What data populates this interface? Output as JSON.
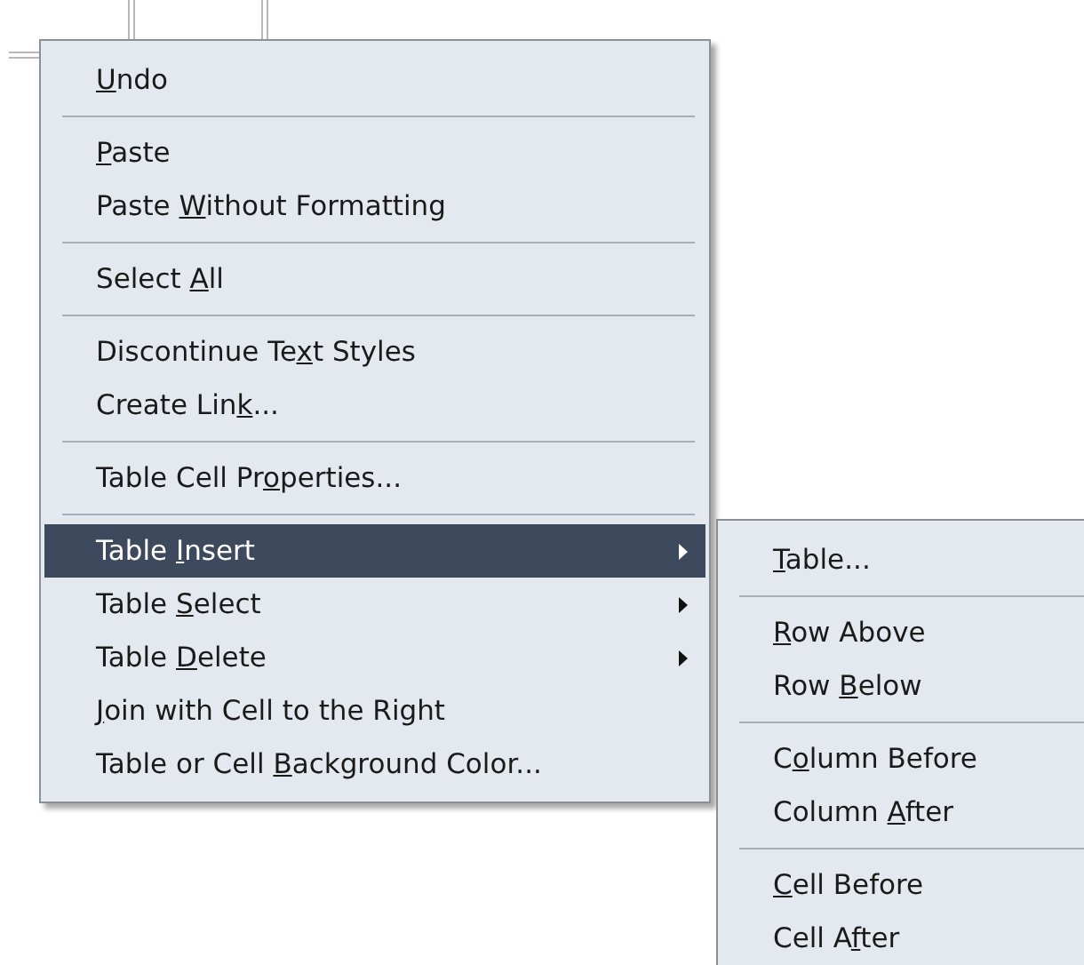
{
  "context_menu": {
    "groups": [
      {
        "items": [
          {
            "key": "U",
            "after": "ndo",
            "selected": false,
            "has_submenu": false
          }
        ]
      },
      {
        "items": [
          {
            "key": "P",
            "after": "aste",
            "selected": false,
            "has_submenu": false
          },
          {
            "before": "Paste ",
            "key": "W",
            "after": "ithout Formatting",
            "selected": false,
            "has_submenu": false
          }
        ]
      },
      {
        "items": [
          {
            "before": "Select ",
            "key": "A",
            "after": "ll",
            "selected": false,
            "has_submenu": false
          }
        ]
      },
      {
        "items": [
          {
            "before": "Discontinue Te",
            "key": "x",
            "after": "t Styles",
            "selected": false,
            "has_submenu": false
          },
          {
            "before": "Create Lin",
            "key": "k",
            "after": "...",
            "selected": false,
            "has_submenu": false
          }
        ]
      },
      {
        "items": [
          {
            "before": "Table Cell Pr",
            "key": "o",
            "after": "perties...",
            "selected": false,
            "has_submenu": false
          }
        ]
      },
      {
        "items": [
          {
            "before": "Table ",
            "key": "I",
            "after": "nsert",
            "selected": true,
            "has_submenu": true
          },
          {
            "before": "Table ",
            "key": "S",
            "after": "elect",
            "selected": false,
            "has_submenu": true
          },
          {
            "before": "Table ",
            "key": "D",
            "after": "elete",
            "selected": false,
            "has_submenu": true
          },
          {
            "key": "J",
            "after": "oin with Cell to the Right",
            "selected": false,
            "has_submenu": false
          },
          {
            "before": "Table or Cell ",
            "key": "B",
            "after": "ackground Color...",
            "selected": false,
            "has_submenu": false
          }
        ]
      }
    ]
  },
  "submenu": {
    "groups": [
      {
        "items": [
          {
            "key": "T",
            "after": "able..."
          }
        ]
      },
      {
        "items": [
          {
            "key": "R",
            "after": "ow Above"
          },
          {
            "before": "Row ",
            "key": "B",
            "after": "elow"
          }
        ]
      },
      {
        "items": [
          {
            "before": "C",
            "key": "o",
            "after": "lumn Before"
          },
          {
            "before": "Column ",
            "key": "A",
            "after": "fter"
          }
        ]
      },
      {
        "items": [
          {
            "key": "C",
            "after": "ell Before"
          },
          {
            "before": "Cell A",
            "key": "f",
            "after": "ter"
          }
        ]
      }
    ]
  }
}
